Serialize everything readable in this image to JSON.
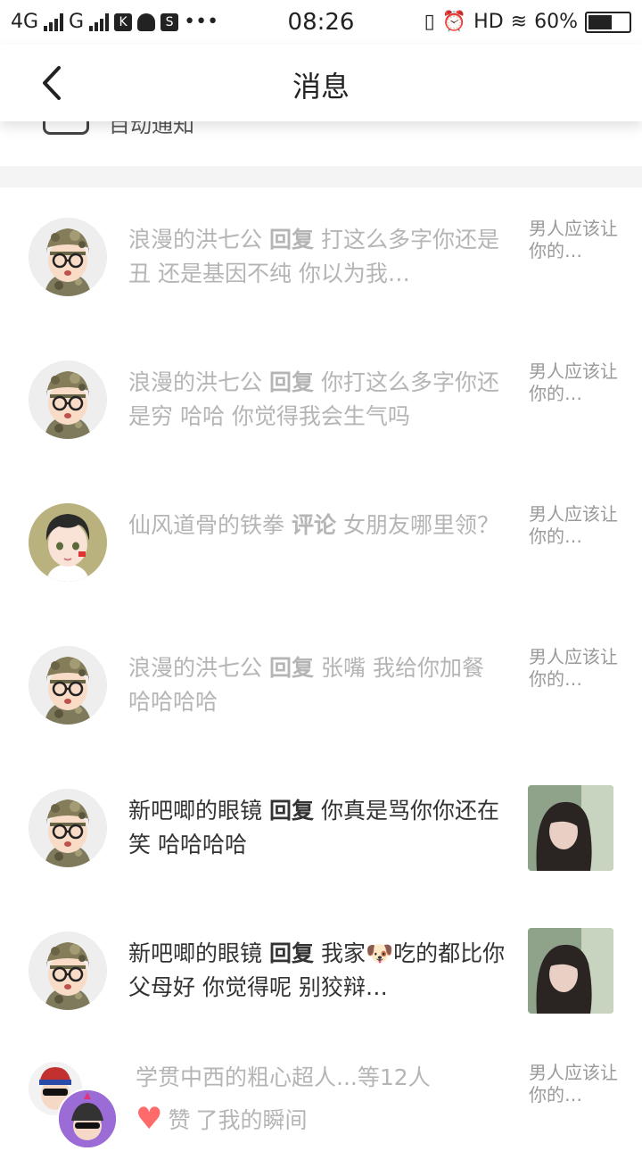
{
  "status_bar": {
    "network_left": "4G",
    "network_right": "G",
    "time": "08:26",
    "hd_label": "HD",
    "battery_percent": "60%",
    "battery_level": 0.6,
    "dots": "•••"
  },
  "header": {
    "title": "消息",
    "back_icon": "chevron-left-icon"
  },
  "peek": {
    "text": "目动通知"
  },
  "messages": [
    {
      "name": "浪漫的洪七公",
      "action": "回复",
      "text": "打这么多字你还是丑 还是基因不纯 你以为我…",
      "right_text": "男人应该让你的…",
      "avatar": "camo-glasses",
      "read": false
    },
    {
      "name": "浪漫的洪七公",
      "action": "回复",
      "text": "你打这么多字你还是穷 哈哈 你觉得我会生气吗",
      "right_text": "男人应该让你的…",
      "avatar": "camo-glasses",
      "read": false
    },
    {
      "name": "仙风道骨的铁拳",
      "action": "评论",
      "text": "女朋友哪里领？",
      "right_text": "男人应该让你的…",
      "avatar": "boy-cartoon",
      "read": false
    },
    {
      "name": "浪漫的洪七公",
      "action": "回复",
      "text": "张嘴 我给你加餐 哈哈哈哈",
      "right_text": "男人应该让你的…",
      "avatar": "camo-glasses",
      "read": false
    },
    {
      "name": "新吧唧的眼镜",
      "action": "回复",
      "text": "你真是骂你你还在笑 哈哈哈哈",
      "right_text": "",
      "avatar": "camo-glasses",
      "read": true
    },
    {
      "name": "新吧唧的眼镜",
      "action": "回复",
      "text": "我家🐶吃的都比你 父母好 你觉得呢 别狡辩…",
      "right_text": "",
      "avatar": "camo-glasses",
      "read": true
    }
  ],
  "likes": {
    "names": "学贯中西的粗心超人...等12人",
    "like_label": "赞",
    "text": "了我的瞬间",
    "right_text": "男人应该让你的…"
  }
}
